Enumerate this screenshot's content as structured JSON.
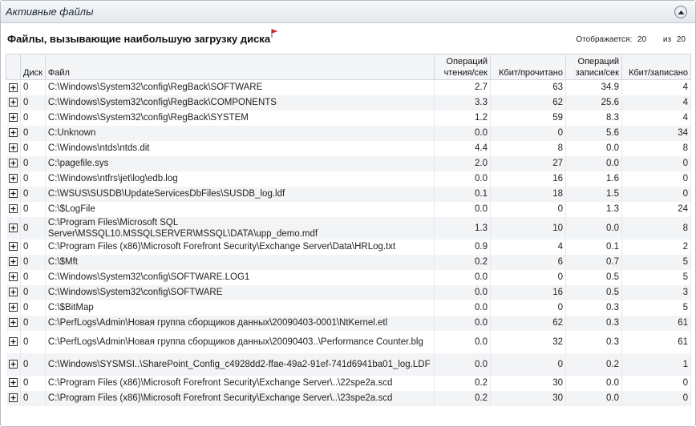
{
  "panel": {
    "title": "Активные файлы",
    "collapse_icon": "chevron-up-icon"
  },
  "subheader": {
    "title": "Файлы, вызывающие наибольшую загрузку диска",
    "shown_label": "Отображается:",
    "shown_value": "20",
    "of_label": "из",
    "total_value": "20",
    "flag_color": "#d9261c"
  },
  "columns": {
    "disk": "Диск",
    "file": "Файл",
    "reads_line1": "Операций",
    "reads_line2": "чтения/сек",
    "kb_read": "Кбит/прочитано",
    "writes_line1": "Операций",
    "writes_line2": "записи/сек",
    "kb_written": "Кбит/записано"
  },
  "rows": [
    {
      "disk": "0",
      "file": "C:\\Windows\\System32\\config\\RegBack\\SOFTWARE",
      "reads": "2.7",
      "kb_read": "63",
      "writes": "34.9",
      "kb_written": "4"
    },
    {
      "disk": "0",
      "file": "C:\\Windows\\System32\\config\\RegBack\\COMPONENTS",
      "reads": "3.3",
      "kb_read": "62",
      "writes": "25.6",
      "kb_written": "4"
    },
    {
      "disk": "0",
      "file": "C:\\Windows\\System32\\config\\RegBack\\SYSTEM",
      "reads": "1.2",
      "kb_read": "59",
      "writes": "8.3",
      "kb_written": "4"
    },
    {
      "disk": "0",
      "file": "C:Unknown",
      "reads": "0.0",
      "kb_read": "0",
      "writes": "5.6",
      "kb_written": "34"
    },
    {
      "disk": "0",
      "file": "C:\\Windows\\ntds\\ntds.dit",
      "reads": "4.4",
      "kb_read": "8",
      "writes": "0.0",
      "kb_written": "8"
    },
    {
      "disk": "0",
      "file": "C:\\pagefile.sys",
      "reads": "2.0",
      "kb_read": "27",
      "writes": "0.0",
      "kb_written": "0"
    },
    {
      "disk": "0",
      "file": "C:\\Windows\\ntfrs\\jet\\log\\edb.log",
      "reads": "0.0",
      "kb_read": "16",
      "writes": "1.6",
      "kb_written": "0"
    },
    {
      "disk": "0",
      "file": "C:\\WSUS\\SUSDB\\UpdateServicesDbFiles\\SUSDB_log.ldf",
      "reads": "0.1",
      "kb_read": "18",
      "writes": "1.5",
      "kb_written": "0"
    },
    {
      "disk": "0",
      "file": "C:\\$LogFile",
      "reads": "0.0",
      "kb_read": "0",
      "writes": "1.3",
      "kb_written": "24"
    },
    {
      "disk": "0",
      "file": "C:\\Program Files\\Microsoft SQL Server\\MSSQL10.MSSQLSERVER\\MSSQL\\DATA\\upp_demo.mdf",
      "reads": "1.3",
      "kb_read": "10",
      "writes": "0.0",
      "kb_written": "8",
      "tall": true
    },
    {
      "disk": "0",
      "file": "C:\\Program Files (x86)\\Microsoft Forefront Security\\Exchange Server\\Data\\HRLog.txt",
      "reads": "0.9",
      "kb_read": "4",
      "writes": "0.1",
      "kb_written": "2"
    },
    {
      "disk": "0",
      "file": "C:\\$Mft",
      "reads": "0.2",
      "kb_read": "6",
      "writes": "0.7",
      "kb_written": "5"
    },
    {
      "disk": "0",
      "file": "C:\\Windows\\System32\\config\\SOFTWARE.LOG1",
      "reads": "0.0",
      "kb_read": "0",
      "writes": "0.5",
      "kb_written": "5"
    },
    {
      "disk": "0",
      "file": "C:\\Windows\\System32\\config\\SOFTWARE",
      "reads": "0.0",
      "kb_read": "16",
      "writes": "0.5",
      "kb_written": "3"
    },
    {
      "disk": "0",
      "file": "C:\\$BitMap",
      "reads": "0.0",
      "kb_read": "0",
      "writes": "0.3",
      "kb_written": "5"
    },
    {
      "disk": "0",
      "file": "C:\\PerfLogs\\Admin\\Новая группа сборщиков данных\\20090403-0001\\NtKernel.etl",
      "reads": "0.0",
      "kb_read": "62",
      "writes": "0.3",
      "kb_written": "61"
    },
    {
      "disk": "0",
      "file": "C:\\PerfLogs\\Admin\\Новая группа сборщиков данных\\20090403..\\Performance Counter.blg",
      "reads": "0.0",
      "kb_read": "32",
      "writes": "0.3",
      "kb_written": "61",
      "tall": true
    },
    {
      "disk": "0",
      "file": "C:\\Windows\\SYSMSI..\\SharePoint_Config_c4928dd2-ffae-49a2-91ef-741d6941ba01_log.LDF",
      "reads": "0.0",
      "kb_read": "0",
      "writes": "0.2",
      "kb_written": "1",
      "tall": true
    },
    {
      "disk": "0",
      "file": "C:\\Program Files (x86)\\Microsoft Forefront Security\\Exchange Server\\..\\22spe2a.scd",
      "reads": "0.2",
      "kb_read": "30",
      "writes": "0.0",
      "kb_written": "0"
    },
    {
      "disk": "0",
      "file": "C:\\Program Files (x86)\\Microsoft Forefront Security\\Exchange Server\\..\\23spe2a.scd",
      "reads": "0.2",
      "kb_read": "30",
      "writes": "0.0",
      "kb_written": "0"
    }
  ]
}
